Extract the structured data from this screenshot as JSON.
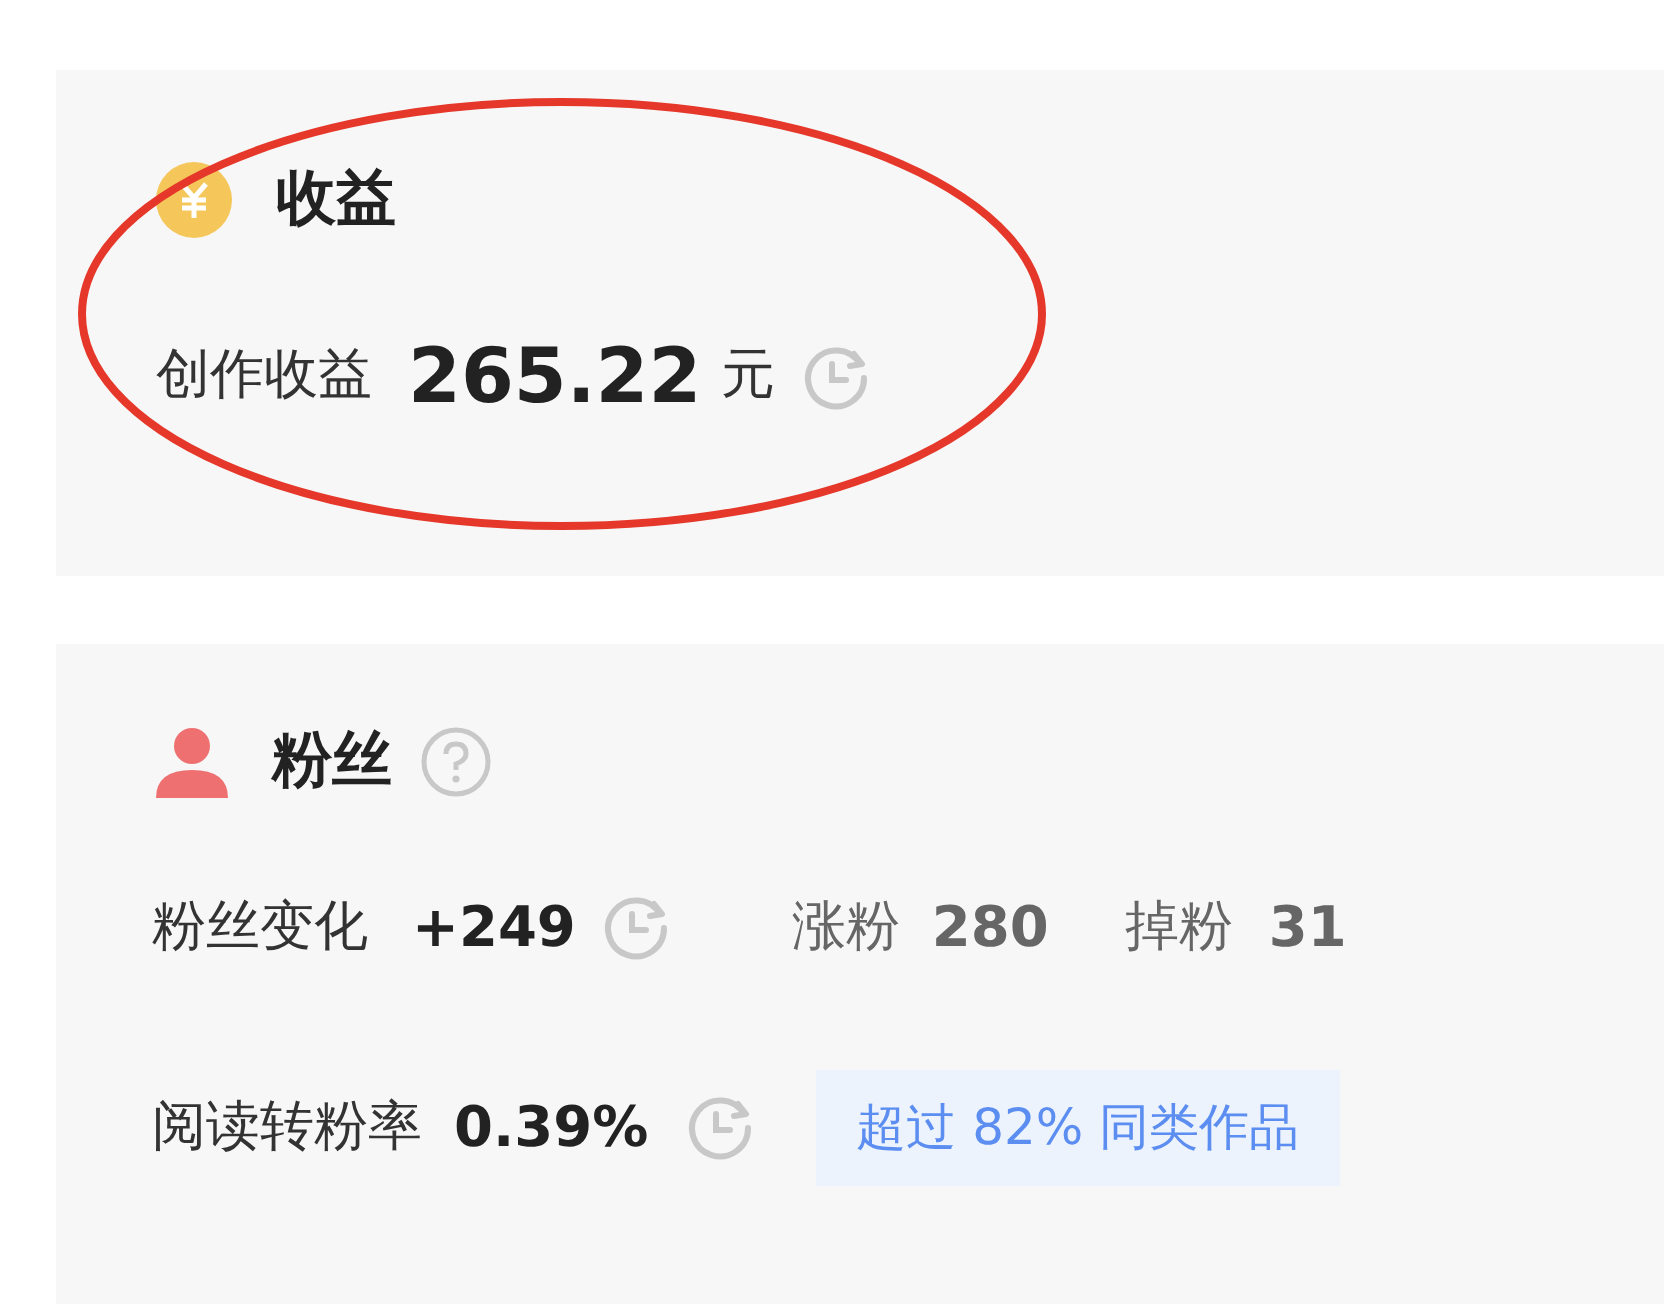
{
  "income": {
    "title": "收益",
    "label": "创作收益",
    "value": "265.22",
    "unit": "元"
  },
  "fans": {
    "title": "粉丝",
    "change_label": "粉丝变化",
    "change_value": "+249",
    "gain_label": "涨粉",
    "gain_value": "280",
    "loss_label": "掉粉",
    "loss_value": "31",
    "rate_label": "阅读转粉率",
    "rate_value": "0.39%",
    "rate_badge": "超过 82% 同类作品"
  }
}
